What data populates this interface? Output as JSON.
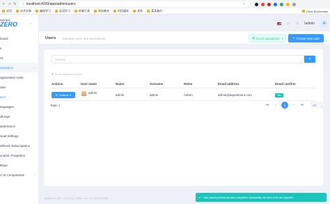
{
  "browser": {
    "url": "localhost:4200/app/admin/users",
    "nav": {
      "back": "←",
      "forward": "→",
      "reload": "↻"
    },
    "bookmarks": [
      "应用",
      "技术文章",
      "编程学习",
      "英语学习",
      "前端工具",
      "网站集合",
      "科技媒体",
      "其他",
      "某某备份"
    ],
    "other_bookmarks": "Other Bookmarks",
    "extension_colors": [
      "#202124",
      "#e8453c",
      "#c5221f",
      "#1a73e8",
      "#34a853",
      "#fbbc04",
      "#9e9e9e"
    ]
  },
  "sidebar": {
    "brand_small": "ABP.NET",
    "brand_large": "ZERO",
    "collapse": "‹",
    "items": [
      {
        "label": "board"
      },
      {
        "label": "s"
      },
      {
        "label": "ns"
      },
      {
        "label": "inistration",
        "expandable": true,
        "active": true
      },
      {
        "label": "rganization Units"
      },
      {
        "label": "oles"
      },
      {
        "label": "sers",
        "current": true
      },
      {
        "label": "anguages"
      },
      {
        "label": "dit logs"
      },
      {
        "label": "aintenance"
      },
      {
        "label": "isual Settings"
      },
      {
        "label": "ebhook Subscriptions"
      },
      {
        "label": "ynamic Properties"
      },
      {
        "label": "ttings"
      },
      {
        "label": "o UI Components",
        "expandable": true
      }
    ]
  },
  "header": {
    "user_name": "\\admin",
    "avatar_letter": "A",
    "language_flag": "en",
    "icons": [
      "chat-icon",
      "bell-icon"
    ]
  },
  "subheader": {
    "title": "Users",
    "subtitle": "Manage users and permissions",
    "excel_label": "Excel operations",
    "create_label": "Create new user"
  },
  "search": {
    "placeholder": "Search...",
    "advanced_filters": "Show advanced filters"
  },
  "table": {
    "columns": [
      "Actions",
      "User name",
      "Name",
      "Surname",
      "Roles",
      "Email address",
      "Email confirm"
    ],
    "rows": [
      {
        "actions_label": "Actions",
        "user_name": "admin",
        "name": "admin",
        "surname": "admin",
        "roles": "Admin",
        "email": "admin@aspnetzero.com",
        "email_confirmed": "Yes"
      }
    ],
    "total": "Total: 1"
  },
  "pagination": {
    "current_page": "1",
    "page_size": "10"
  },
  "footer": {
    "text": "Q4Demo [API: v11.0.0] | Client: v11.0.0 [20221028]"
  },
  "toast": {
    "message": "User import process has been completed successfully. All users in file are imported."
  },
  "colors": {
    "primary": "#3699ff",
    "success": "#1bc5bd",
    "background": "#eef0f8"
  }
}
